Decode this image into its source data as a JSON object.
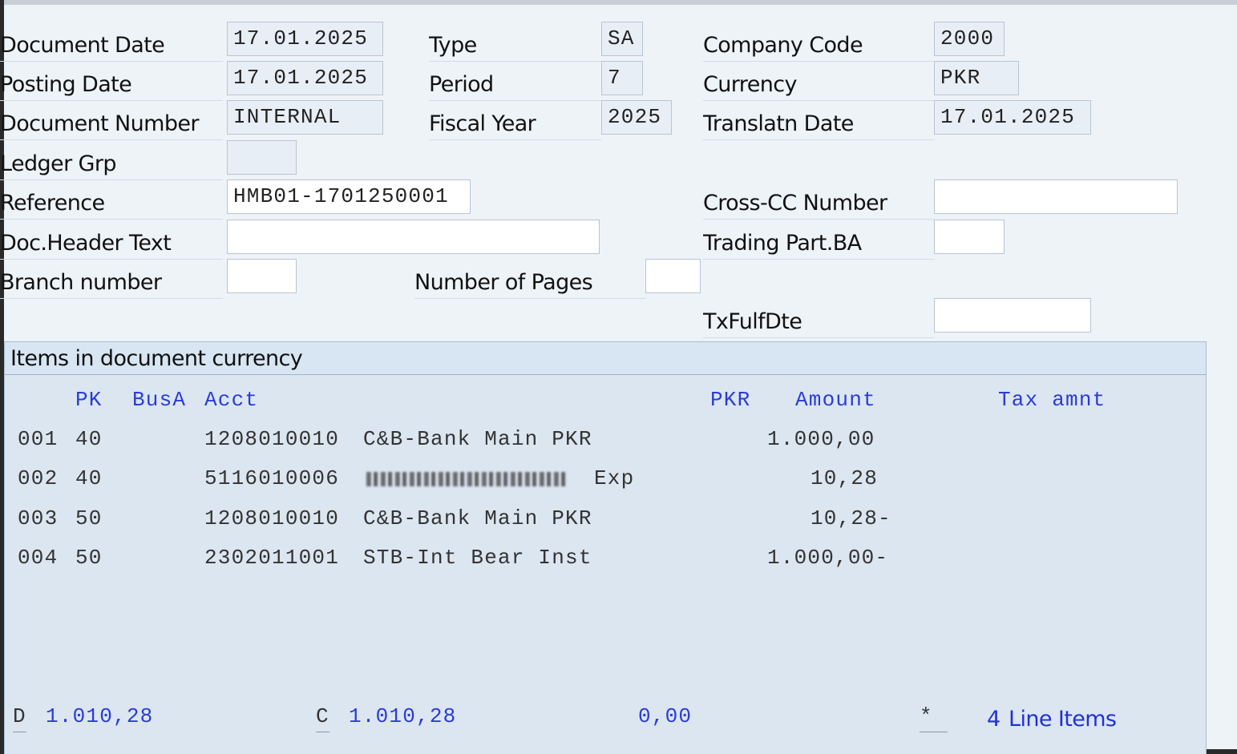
{
  "header": {
    "document_date": {
      "label": "Document Date",
      "value": "17.01.2025"
    },
    "posting_date": {
      "label": "Posting Date",
      "value": "17.01.2025"
    },
    "document_number": {
      "label": "Document Number",
      "value": "INTERNAL"
    },
    "ledger_grp": {
      "label": "Ledger Grp",
      "value": ""
    },
    "reference": {
      "label": "Reference",
      "value": "HMB01-1701250001"
    },
    "doc_header_text": {
      "label": "Doc.Header Text",
      "value": ""
    },
    "branch_number": {
      "label": "Branch number",
      "value": ""
    },
    "type": {
      "label": "Type",
      "value": "SA"
    },
    "period": {
      "label": "Period",
      "value": "7"
    },
    "fiscal_year": {
      "label": "Fiscal Year",
      "value": "2025"
    },
    "number_of_pages": {
      "label": "Number of Pages",
      "value": ""
    },
    "company_code": {
      "label": "Company Code",
      "value": "2000"
    },
    "currency": {
      "label": "Currency",
      "value": "PKR"
    },
    "translatn_date": {
      "label": "Translatn Date",
      "value": "17.01.2025"
    },
    "cross_cc_number": {
      "label": "Cross-CC Number",
      "value": ""
    },
    "trading_part_ba": {
      "label": "Trading Part.BA",
      "value": ""
    },
    "tx_fulf_dte": {
      "label": "TxFulfDte",
      "value": ""
    }
  },
  "items": {
    "title": "Items in document currency",
    "columns": {
      "pk": "PK",
      "busa": "BusA",
      "acct": "Acct",
      "currency": "PKR",
      "amount": "Amount",
      "tax": "Tax amnt"
    },
    "rows": [
      {
        "no": "001",
        "pk": "40",
        "acct": "1208010010",
        "desc": "C&B-Bank Main PKR",
        "amount": "1.000,00"
      },
      {
        "no": "002",
        "pk": "40",
        "acct": "5116010006",
        "desc": "Exp",
        "amount": "10,28"
      },
      {
        "no": "003",
        "pk": "50",
        "acct": "1208010010",
        "desc": "C&B-Bank Main PKR",
        "amount": "10,28-"
      },
      {
        "no": "004",
        "pk": "50",
        "acct": "2302011001",
        "desc": "STB-Int Bear Inst",
        "amount": "1.000,00-"
      }
    ]
  },
  "footer": {
    "debit_tag": "D",
    "debit_total": "1.010,28",
    "credit_tag": "C",
    "credit_total": "1.010,28",
    "balance": "0,00",
    "star": "*",
    "line_items_count": "4",
    "line_items_label": "Line Items"
  },
  "colors": {
    "header_text": "#2b3bd9",
    "background": "#eef3f8",
    "panel": "#dbe6f0"
  }
}
